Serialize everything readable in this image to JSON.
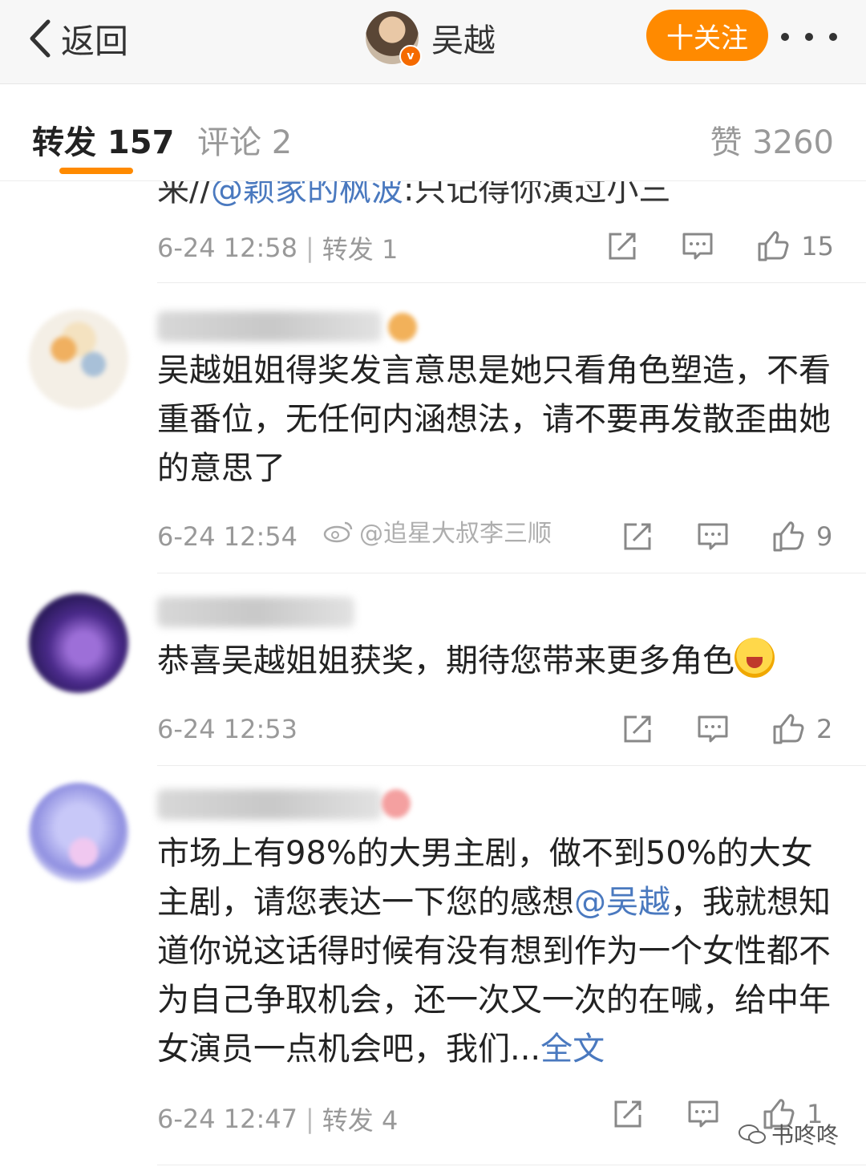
{
  "nav": {
    "back_label": "返回",
    "title": "吴越",
    "verified_badge": "v",
    "follow_label": "十关注",
    "more_icon": "more-dots-icon"
  },
  "tabs": {
    "repost": "转发 157",
    "comment": "评论 2",
    "like": "赞 3260"
  },
  "partial_post": {
    "text_prefix": "来//",
    "mention": "@颖家的枫波",
    "text_suffix": ":只记得你演过小三",
    "time": "6-24 12:58",
    "repost": "转发 1",
    "likes": "15"
  },
  "comments": [
    {
      "text": "吴越姐姐得奖发言意思是她只看角色塑造，不看重番位，无任何内涵想法，请不要再发散歪曲她的意思了",
      "time": "6-24 12:54",
      "likes": "9"
    },
    {
      "text": "恭喜吴越姐姐获奖，期待您带来更多角色",
      "time": "6-24 12:53",
      "likes": "2"
    },
    {
      "text_part1": "市场上有98%的大男主剧，做不到50%的大女主剧，请您表达一下您的感想",
      "mention": "@吴越",
      "text_part2": "，我就想知道你说这话得时候有没有想到作为一个女性都不为自己争取机会，还一次又一次的在喊，给中年女演员一点机会吧，我们...",
      "fulltext_label": "全文",
      "time": "6-24 12:47",
      "repost": "转发 4",
      "likes": "1"
    }
  ],
  "watermarks": {
    "mid": "@追星大叔李三顺",
    "bottom": "书咚咚"
  },
  "colors": {
    "accent": "#ff8a00",
    "link": "#4a79bf",
    "meta": "#999999"
  }
}
